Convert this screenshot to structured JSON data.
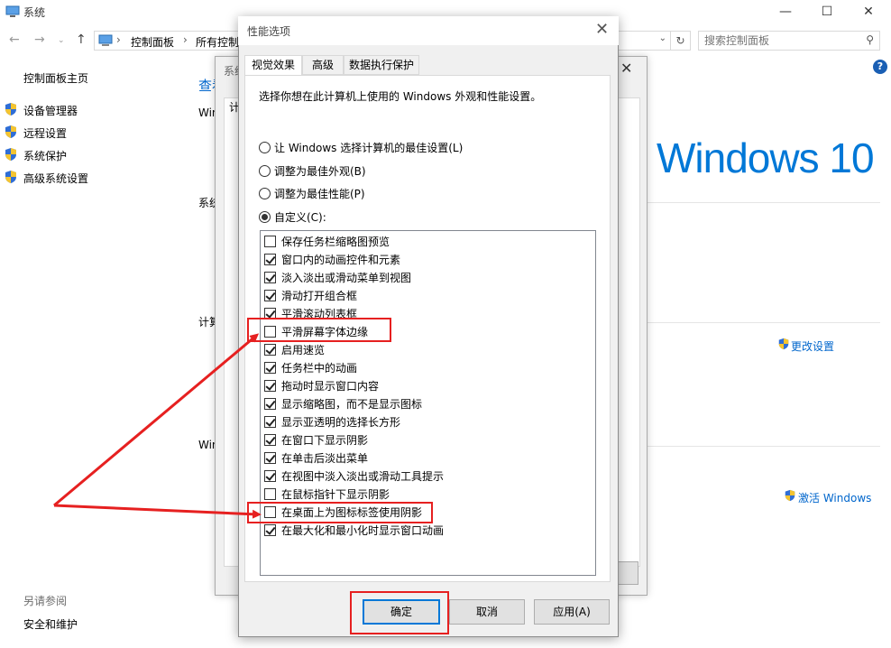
{
  "system_window": {
    "title": "系统",
    "breadcrumb": [
      "控制面板",
      "所有控制"
    ],
    "search_placeholder": "搜索控制面板",
    "left_nav": {
      "home": "控制面板主页",
      "items": [
        "设备管理器",
        "远程设置",
        "系统保护",
        "高级系统设置"
      ],
      "see_also_heading": "另请参阅",
      "see_also_items": [
        "安全和维护"
      ]
    },
    "fragments": {
      "view_link": "查看",
      "win_a": "Win",
      "sys_label": "系统",
      "comp_label": "计算",
      "win_b": "Win"
    },
    "brand": "Windows 10",
    "change_settings": "更改设置",
    "activate_windows": "激活 Windows"
  },
  "bg_dialog": {
    "title_fragment": "系统",
    "tab_fragment": "计"
  },
  "perf_dialog": {
    "title": "性能选项",
    "tabs": [
      "视觉效果",
      "高级",
      "数据执行保护"
    ],
    "active_tab": 0,
    "intro": "选择你想在此计算机上使用的 Windows 外观和性能设置。",
    "radios": [
      {
        "label": "让 Windows 选择计算机的最佳设置(L)",
        "checked": false
      },
      {
        "label": "调整为最佳外观(B)",
        "checked": false
      },
      {
        "label": "调整为最佳性能(P)",
        "checked": false
      },
      {
        "label": "自定义(C):",
        "checked": true
      }
    ],
    "options": [
      {
        "label": "保存任务栏缩略图预览",
        "checked": false
      },
      {
        "label": "窗口内的动画控件和元素",
        "checked": true
      },
      {
        "label": "淡入淡出或滑动菜单到视图",
        "checked": true
      },
      {
        "label": "滑动打开组合框",
        "checked": true
      },
      {
        "label": "平滑滚动列表框",
        "checked": true
      },
      {
        "label": "平滑屏幕字体边缘",
        "checked": false
      },
      {
        "label": "启用速览",
        "checked": true
      },
      {
        "label": "任务栏中的动画",
        "checked": true
      },
      {
        "label": "拖动时显示窗口内容",
        "checked": true
      },
      {
        "label": "显示缩略图，而不是显示图标",
        "checked": true
      },
      {
        "label": "显示亚透明的选择长方形",
        "checked": true
      },
      {
        "label": "在窗口下显示阴影",
        "checked": true
      },
      {
        "label": "在单击后淡出菜单",
        "checked": true
      },
      {
        "label": "在视图中淡入淡出或滑动工具提示",
        "checked": true
      },
      {
        "label": "在鼠标指针下显示阴影",
        "checked": false
      },
      {
        "label": "在桌面上为图标标签使用阴影",
        "checked": false
      },
      {
        "label": "在最大化和最小化时显示窗口动画",
        "checked": true
      }
    ],
    "buttons": {
      "ok": "确定",
      "cancel": "取消",
      "apply": "应用(A)"
    }
  },
  "colors": {
    "accent": "#0078d7",
    "annotation_red": "#e62020"
  }
}
